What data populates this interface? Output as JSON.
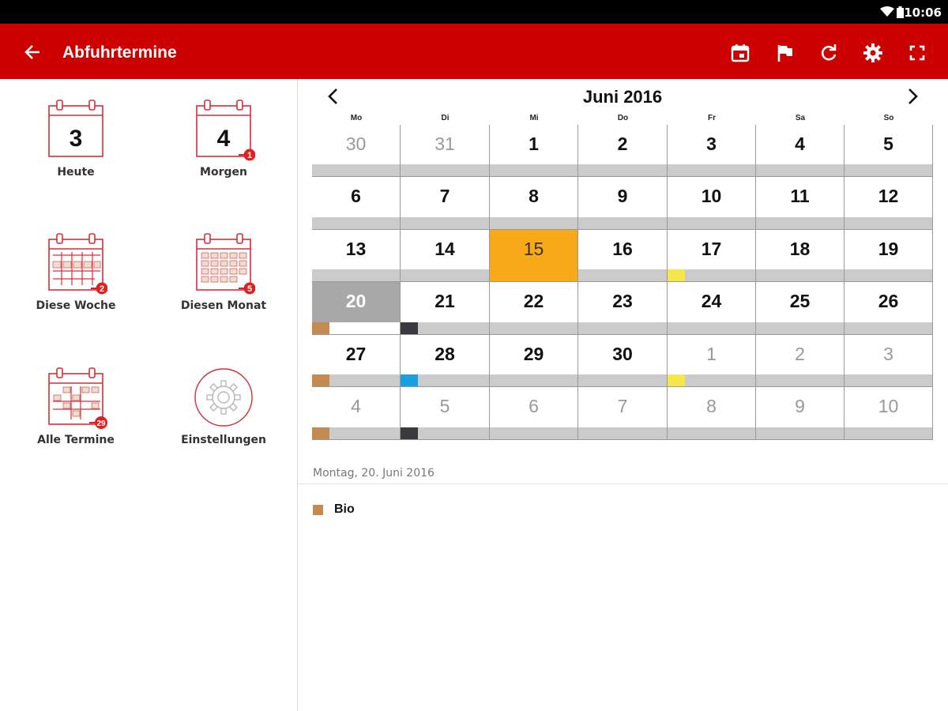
{
  "status": {
    "time": "10:06"
  },
  "appbar": {
    "title": "Abfuhrtermine"
  },
  "tiles": {
    "today": {
      "label": "Heute",
      "day": "3"
    },
    "tomorrow": {
      "label": "Morgen",
      "day": "4",
      "badge": "1"
    },
    "week": {
      "label": "Diese Woche",
      "badge": "2"
    },
    "month": {
      "label": "Diesen Monat",
      "badge": "5"
    },
    "all": {
      "label": "Alle Termine",
      "badge": "29"
    },
    "settings": {
      "label": "Einstellungen"
    }
  },
  "calendar": {
    "month_title": "Juni 2016",
    "weekdays": [
      "Mo",
      "Di",
      "Mi",
      "Do",
      "Fr",
      "Sa",
      "So"
    ],
    "weeks": [
      [
        {
          "d": "30",
          "o": true
        },
        {
          "d": "31",
          "o": true
        },
        {
          "d": "1"
        },
        {
          "d": "2"
        },
        {
          "d": "3"
        },
        {
          "d": "4"
        },
        {
          "d": "5"
        }
      ],
      [
        {
          "d": "6"
        },
        {
          "d": "7"
        },
        {
          "d": "8"
        },
        {
          "d": "9"
        },
        {
          "d": "10"
        },
        {
          "d": "11"
        },
        {
          "d": "12"
        }
      ],
      [
        {
          "d": "13"
        },
        {
          "d": "14"
        },
        {
          "d": "15",
          "today": true
        },
        {
          "d": "16"
        },
        {
          "d": "17",
          "m": "#f5e74a"
        },
        {
          "d": "18"
        },
        {
          "d": "19"
        }
      ],
      [
        {
          "d": "20",
          "sel": true,
          "m": "#c48a4f"
        },
        {
          "d": "21",
          "m": "#3a3a3e"
        },
        {
          "d": "22"
        },
        {
          "d": "23"
        },
        {
          "d": "24"
        },
        {
          "d": "25"
        },
        {
          "d": "26"
        }
      ],
      [
        {
          "d": "27",
          "m": "#c48a4f"
        },
        {
          "d": "28",
          "m": "#1a9fe0"
        },
        {
          "d": "29"
        },
        {
          "d": "30"
        },
        {
          "d": "1",
          "o": true,
          "m": "#f5e74a"
        },
        {
          "d": "2",
          "o": true
        },
        {
          "d": "3",
          "o": true
        }
      ],
      [
        {
          "d": "4",
          "o": true,
          "m": "#c48a4f"
        },
        {
          "d": "5",
          "o": true,
          "m": "#3a3a3e"
        },
        {
          "d": "6",
          "o": true
        },
        {
          "d": "7",
          "o": true
        },
        {
          "d": "8",
          "o": true
        },
        {
          "d": "9",
          "o": true
        },
        {
          "d": "10",
          "o": true
        }
      ]
    ]
  },
  "selected": {
    "date_label": "Montag, 20. Juni 2016",
    "events": [
      {
        "name": "Bio",
        "color": "#c48a4f"
      }
    ]
  },
  "colors": {
    "brand": "#cc0000",
    "today": "#f7a918",
    "selected": "#a8a8a8"
  },
  "icons": [
    "back-arrow-icon",
    "calendar-today-icon",
    "flag-icon",
    "refresh-icon",
    "gear-icon",
    "fullscreen-icon"
  ]
}
